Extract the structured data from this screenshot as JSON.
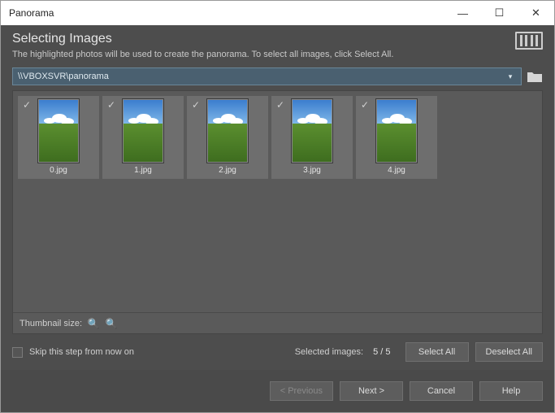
{
  "window": {
    "title": "Panorama"
  },
  "header": {
    "title": "Selecting Images",
    "subtitle": "The highlighted photos will be used to create the panorama. To select all images, click Select All."
  },
  "path": {
    "value": "\\\\VBOXSVR\\panorama"
  },
  "thumbs": {
    "items": [
      {
        "name": "0.jpg",
        "selected": true
      },
      {
        "name": "1.jpg",
        "selected": true
      },
      {
        "name": "2.jpg",
        "selected": true
      },
      {
        "name": "3.jpg",
        "selected": true
      },
      {
        "name": "4.jpg",
        "selected": true
      }
    ],
    "size_label": "Thumbnail size:"
  },
  "skip": {
    "label": "Skip this step from now on",
    "checked": false
  },
  "selection": {
    "label": "Selected images:",
    "count": "5 / 5"
  },
  "buttons": {
    "select_all": "Select All",
    "deselect_all": "Deselect All",
    "previous": "< Previous",
    "next": "Next >",
    "cancel": "Cancel",
    "help": "Help"
  }
}
